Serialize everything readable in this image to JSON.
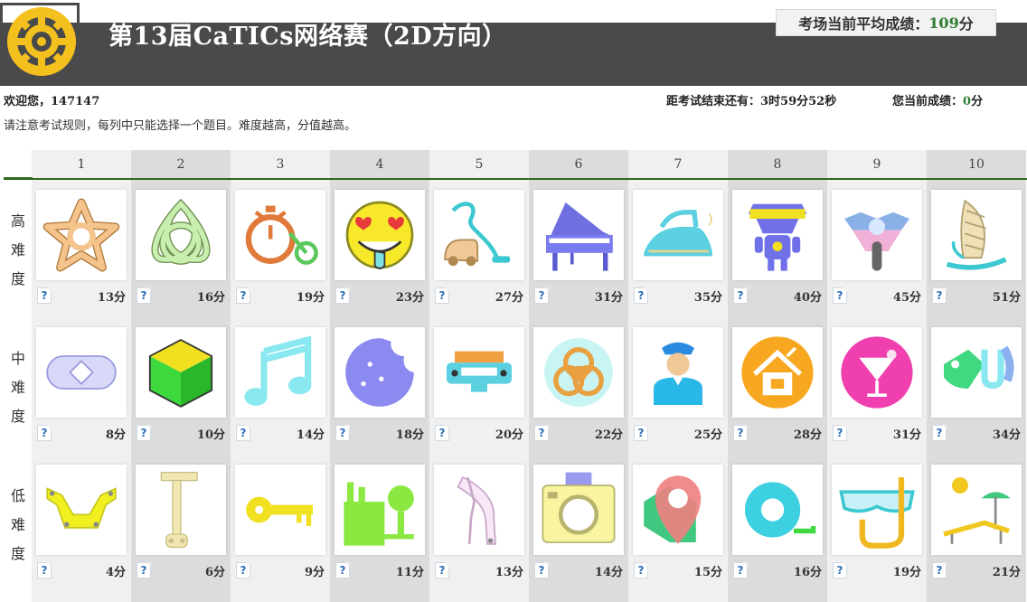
{
  "header": {
    "title": "第13届CaTICs网络赛（2D方向）",
    "avg_label": "考场当前平均成绩：",
    "avg_value": "109",
    "avg_unit": "分"
  },
  "status": {
    "welcome": "欢迎您，147147",
    "timer": "距考试结束还有：3时59分52秒",
    "current_label": "您当前成绩：",
    "current_value": "0",
    "current_unit": "分"
  },
  "rules": "请注意考试规则，每列中只能选择一个题目。难度越高，分值越高。",
  "columns": [
    "1",
    "2",
    "3",
    "4",
    "5",
    "6",
    "7",
    "8",
    "9",
    "10"
  ],
  "help_glyph": "?",
  "rows": [
    {
      "label": [
        "高",
        "难",
        "度"
      ],
      "items": [
        {
          "icon": "celtic-star-knot-icon",
          "score": "13分"
        },
        {
          "icon": "triquetra-knot-icon",
          "score": "16分"
        },
        {
          "icon": "stopwatch-bicycle-icon",
          "score": "19分"
        },
        {
          "icon": "heart-eyes-emoji-icon",
          "score": "23分"
        },
        {
          "icon": "vacuum-cleaner-icon",
          "score": "27分"
        },
        {
          "icon": "grand-piano-icon",
          "score": "31分"
        },
        {
          "icon": "steam-iron-icon",
          "score": "35分"
        },
        {
          "icon": "robot-visor-icon",
          "score": "40分"
        },
        {
          "icon": "motorcycle-front-icon",
          "score": "45分"
        },
        {
          "icon": "windsurf-board-icon",
          "score": "51分"
        }
      ]
    },
    {
      "label": [
        "中",
        "难",
        "度"
      ],
      "items": [
        {
          "icon": "diamond-badge-icon",
          "score": "8分"
        },
        {
          "icon": "cube-icon",
          "score": "10分"
        },
        {
          "icon": "music-note-icon",
          "score": "14分"
        },
        {
          "icon": "bitten-cookie-icon",
          "score": "18分"
        },
        {
          "icon": "car-part-icon",
          "score": "20分"
        },
        {
          "icon": "biohazard-icon",
          "score": "22分"
        },
        {
          "icon": "police-officer-icon",
          "score": "25分"
        },
        {
          "icon": "house-tools-icon",
          "score": "28分"
        },
        {
          "icon": "cocktail-glass-icon",
          "score": "31分"
        },
        {
          "icon": "mechanical-bracket-icon",
          "score": "34分"
        }
      ]
    },
    {
      "label": [
        "低",
        "难",
        "度"
      ],
      "items": [
        {
          "icon": "bracket-plate-icon",
          "score": "4分"
        },
        {
          "icon": "key-lever-icon",
          "score": "6分"
        },
        {
          "icon": "key-icon",
          "score": "9分"
        },
        {
          "icon": "factory-icon",
          "score": "11分"
        },
        {
          "icon": "bent-lever-icon",
          "score": "13分"
        },
        {
          "icon": "camera-icon",
          "score": "14分"
        },
        {
          "icon": "map-pin-gear-icon",
          "score": "15分"
        },
        {
          "icon": "tape-measure-icon",
          "score": "16分"
        },
        {
          "icon": "snorkel-mask-icon",
          "score": "19分"
        },
        {
          "icon": "beach-lounger-icon",
          "score": "21分"
        }
      ]
    }
  ],
  "colors": {
    "header_bg": "#4a4a4a",
    "logo_yellow": "#f4c01e",
    "accent_green": "#2e6b1e",
    "score_green": "#2e7d32",
    "col_light": "#f0f0f0",
    "col_dark": "#dcdcdc"
  }
}
